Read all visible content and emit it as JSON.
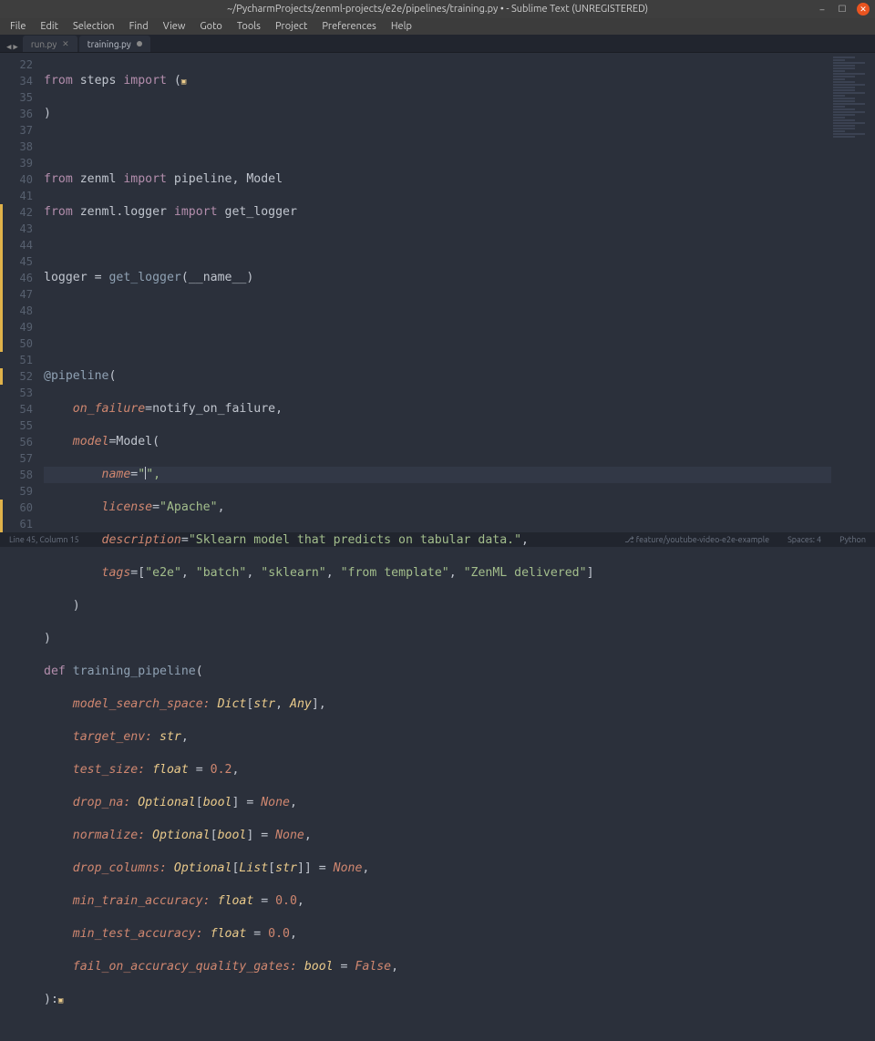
{
  "window": {
    "title": "~/PycharmProjects/zenml-projects/e2e/pipelines/training.py • - Sublime Text (UNREGISTERED)"
  },
  "menu": [
    "File",
    "Edit",
    "Selection",
    "Find",
    "View",
    "Goto",
    "Tools",
    "Project",
    "Preferences",
    "Help"
  ],
  "tabs": [
    {
      "label": "run.py",
      "active": false
    },
    {
      "label": "training.py",
      "active": true
    }
  ],
  "gutter_start": 22,
  "line_numbers": [
    22,
    34,
    35,
    36,
    37,
    38,
    39,
    40,
    41,
    42,
    43,
    44,
    45,
    46,
    47,
    48,
    49,
    50,
    51,
    52,
    53,
    54,
    55,
    56,
    57,
    58,
    59,
    60,
    61
  ],
  "modified_lines": [
    42,
    43,
    44,
    45,
    46,
    47,
    48,
    49,
    50,
    52,
    60,
    61
  ],
  "code": {
    "l22": {
      "pre": "from",
      "mid": " steps ",
      "post": "import",
      "rest": " ("
    },
    "l34": ")",
    "l36": {
      "a": "from",
      "b": " zenml ",
      "c": "import",
      "d": " pipeline, Model"
    },
    "l37": {
      "a": "from",
      "b": " zenml.logger ",
      "c": "import",
      "d": " get_logger"
    },
    "l39": {
      "a": "logger ",
      "b": "=",
      "c": " get_logger",
      "d": "(__name__)"
    },
    "l42": {
      "a": "@pipeline",
      "b": "("
    },
    "l43": {
      "a": "    on_failure",
      "b": "=",
      "c": "notify_on_failure,"
    },
    "l44": {
      "a": "    model",
      "b": "=",
      "c": "Model("
    },
    "l45": {
      "a": "        name",
      "b": "=",
      "c": "\"",
      "d": "\","
    },
    "l46": {
      "a": "        license",
      "b": "=",
      "c": "\"Apache\"",
      "d": ","
    },
    "l47": {
      "a": "        description",
      "b": "=",
      "c": "\"Sklearn model that predicts on tabular data.\"",
      "d": ","
    },
    "l48": {
      "a": "        tags",
      "b": "=",
      "c": "[",
      "s1": "\"e2e\"",
      "p1": ", ",
      "s2": "\"batch\"",
      "p2": ", ",
      "s3": "\"sklearn\"",
      "p3": ", ",
      "s4": "\"from template\"",
      "p4": ", ",
      "s5": "\"ZenML delivered\"",
      "d": "]"
    },
    "l49": "    )",
    "l50": ")",
    "l51": {
      "a": "def",
      "b": " training_pipeline",
      "c": "("
    },
    "l52": {
      "a": "    model_search_space: ",
      "t": "Dict",
      "b": "[",
      "t2": "str",
      "c": ", ",
      "t3": "Any",
      "d": "],"
    },
    "l53": {
      "a": "    target_env: ",
      "t": "str",
      "b": ","
    },
    "l54": {
      "a": "    test_size: ",
      "t": "float",
      "b": " = ",
      "n": "0.2",
      "c": ","
    },
    "l55": {
      "a": "    drop_na: ",
      "t": "Optional",
      "b": "[",
      "t2": "bool",
      "c": "] = ",
      "k": "None",
      "d": ","
    },
    "l56": {
      "a": "    normalize: ",
      "t": "Optional",
      "b": "[",
      "t2": "bool",
      "c": "] = ",
      "k": "None",
      "d": ","
    },
    "l57": {
      "a": "    drop_columns: ",
      "t": "Optional",
      "b": "[",
      "t2": "List",
      "c": "[",
      "t3": "str",
      "d": "]] = ",
      "k": "None",
      "e": ","
    },
    "l58": {
      "a": "    min_train_accuracy: ",
      "t": "float",
      "b": " = ",
      "n": "0.0",
      "c": ","
    },
    "l59": {
      "a": "    min_test_accuracy: ",
      "t": "float",
      "b": " = ",
      "n": "0.0",
      "c": ","
    },
    "l60": {
      "a": "    fail_on_accuracy_quality_gates: ",
      "t": "bool",
      "b": " = ",
      "k": "False",
      "c": ","
    },
    "l61": "):"
  },
  "status": {
    "left": "Line 45, Column 15",
    "branch": "feature/youtube-video-e2e-example",
    "spaces": "Spaces: 4",
    "syntax": "Python"
  }
}
